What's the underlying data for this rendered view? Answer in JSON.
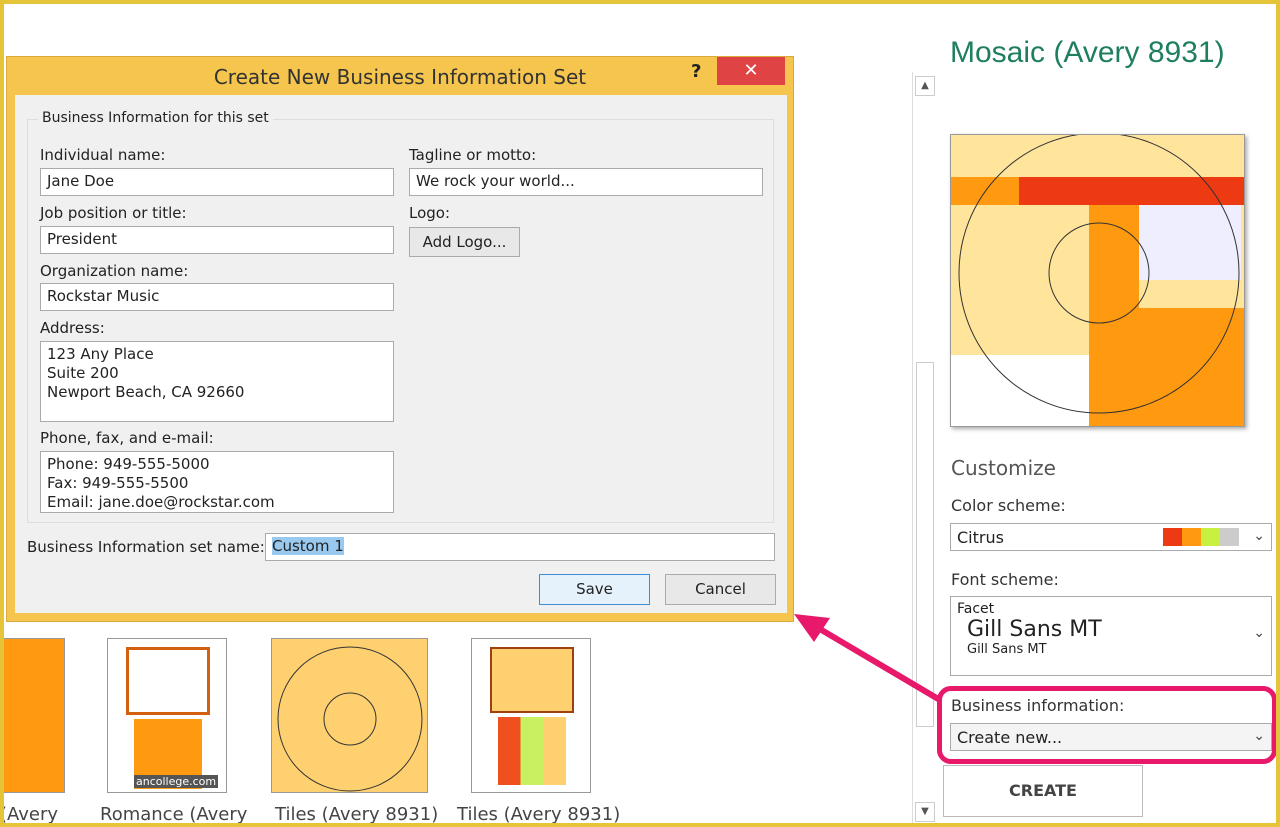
{
  "panel": {
    "title": "Mosaic (Avery 8931)",
    "customize": "Customize",
    "color_scheme_label": "Color scheme:",
    "color_scheme_value": "Citrus",
    "color_swatches": [
      "#ee3a12",
      "#ff9a10",
      "#c8f040",
      "#cccccc"
    ],
    "font_scheme_label": "Font scheme:",
    "font_scheme_name": "Facet",
    "font_heading": "Gill Sans MT",
    "font_body": "Gill Sans MT",
    "business_info_label": "Business information:",
    "business_info_value": "Create new...",
    "create_label": "CREATE",
    "accent": "#e8186b"
  },
  "dialog": {
    "title": "Create New Business Information Set",
    "help": "?",
    "close": "✕",
    "group_label": "Business Information for this set",
    "individual_name_label": "Individual name:",
    "individual_name": "Jane Doe",
    "job_label": "Job position or title:",
    "job": "President",
    "org_label": "Organization name:",
    "org": "Rockstar Music",
    "address_label": "Address:",
    "address": "123 Any Place\nSuite 200\nNewport Beach, CA 92660",
    "phone_label": "Phone, fax, and e-mail:",
    "phone": "Phone: 949-555-5000\nFax: 949-555-5500\nEmail: jane.doe@rockstar.com",
    "tagline_label": "Tagline or motto:",
    "tagline": "We rock your world...",
    "logo_label": "Logo:",
    "add_logo": "Add Logo...",
    "set_name_label": "Business Information set name:",
    "set_name": "Custom 1",
    "save": "Save",
    "cancel": "Cancel"
  },
  "templates": [
    {
      "label": "(Avery"
    },
    {
      "label": "Romance (Avery"
    },
    {
      "label": "Tiles (Avery 8931)"
    },
    {
      "label": "Tiles (Avery 8931)"
    }
  ],
  "watermark": "ancollege.com"
}
